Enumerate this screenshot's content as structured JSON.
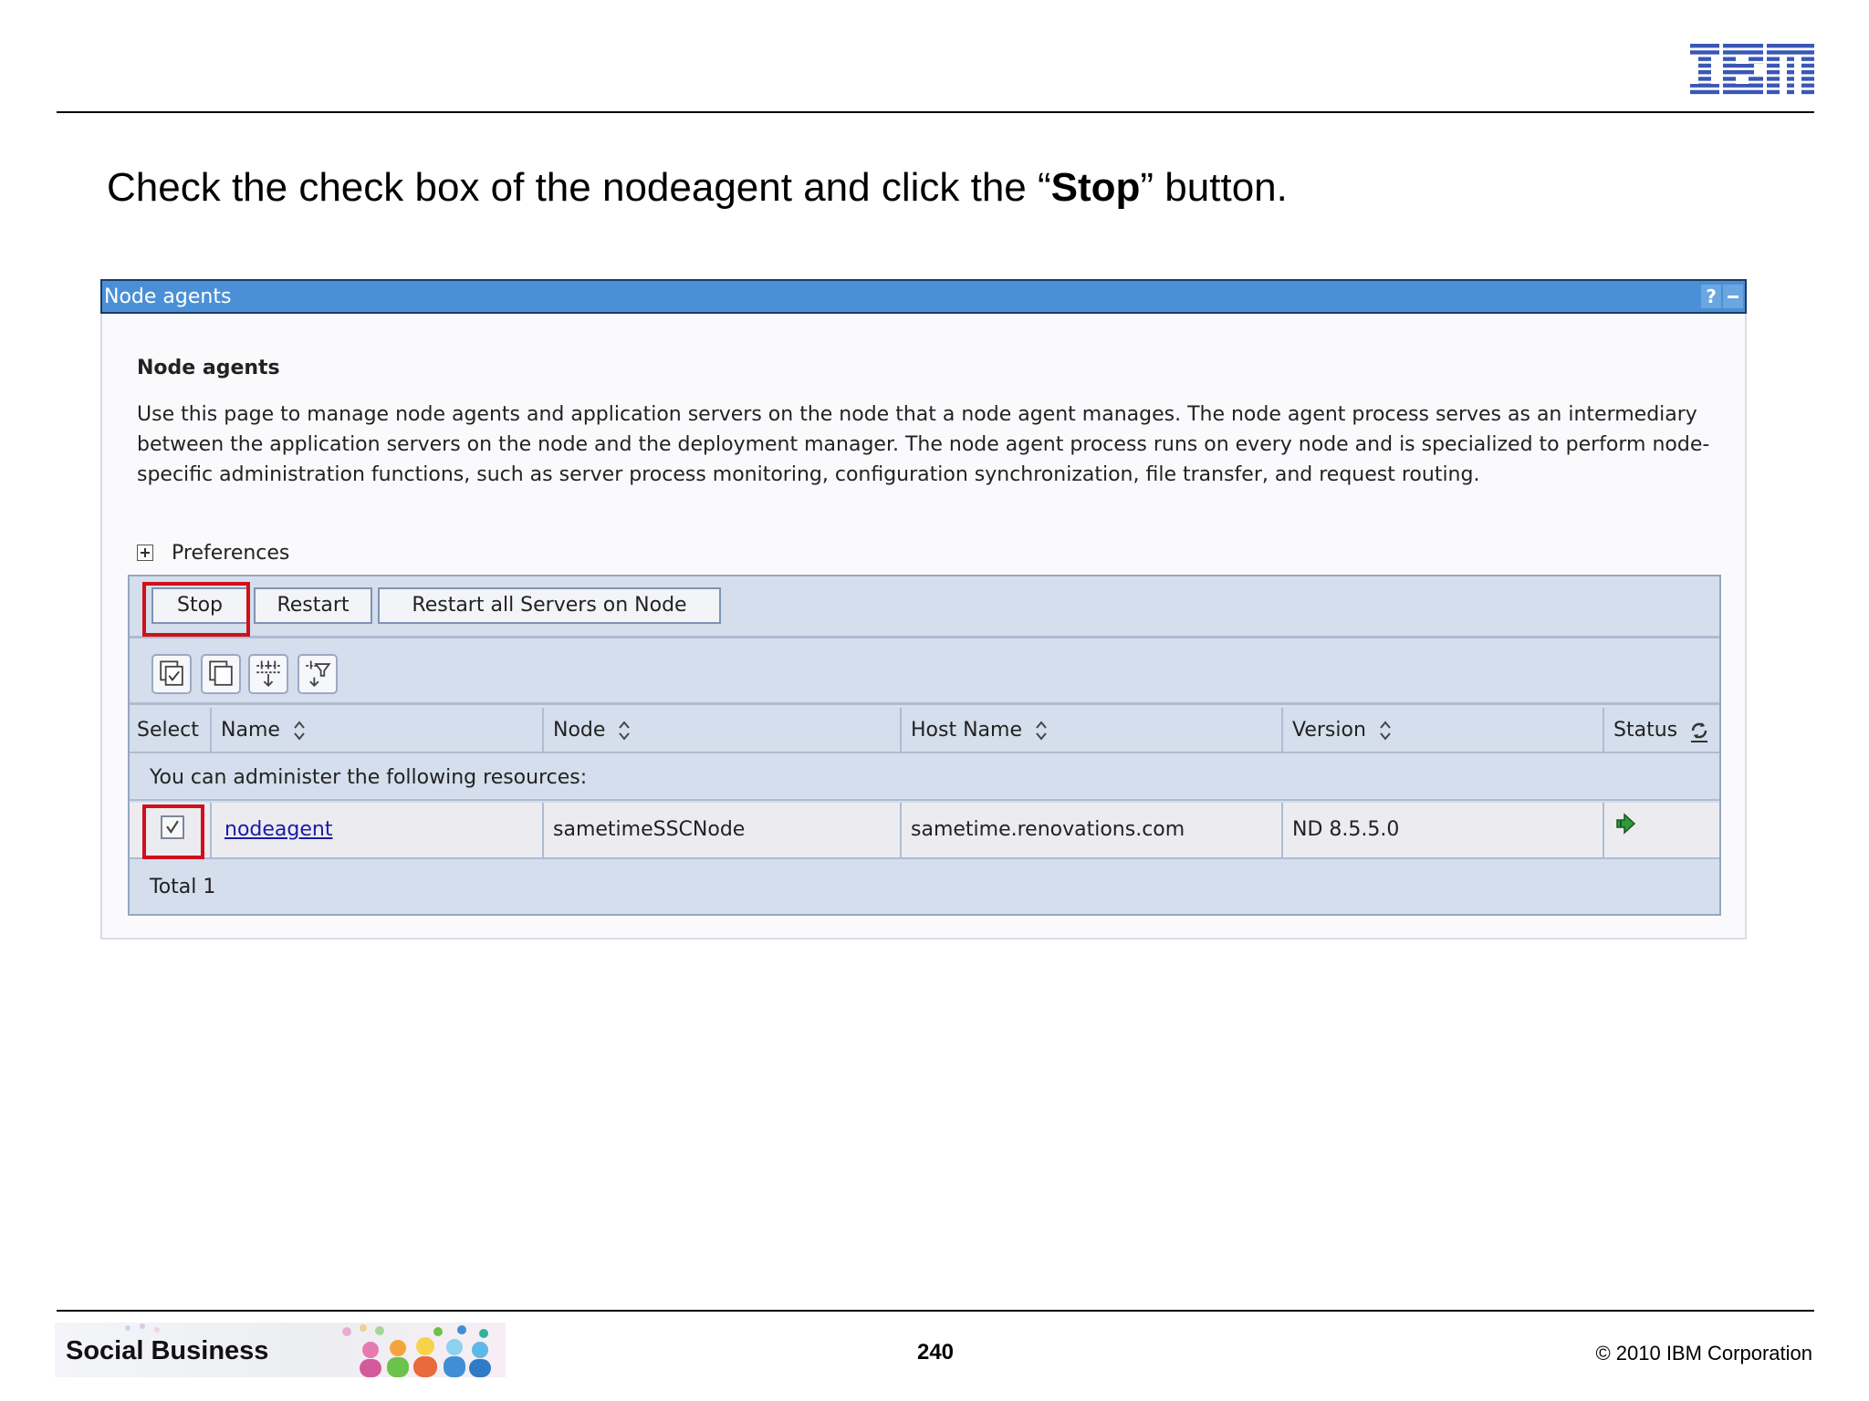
{
  "slide": {
    "logo_text": "IBM",
    "instruction": {
      "prefix": "Check the check box of the nodeagent and click the “",
      "emphasis": "Stop",
      "suffix": "” button."
    },
    "footer": {
      "brand": "Social Business",
      "page_number": "240",
      "copyright": "© 2010 IBM Corporation"
    }
  },
  "portlet": {
    "titlebar": "Node agents",
    "help_label": "?",
    "heading": "Node agents",
    "description": "Use this page to manage node agents and application servers on the node that a node agent manages. The node agent process serves as an intermediary between the application servers on the node and the deployment manager. The node agent process runs on every node and is specialized to perform node-specific administration functions, such as server process monitoring, configuration synchronization, file transfer, and request routing.",
    "preferences_label": "Preferences",
    "buttons": {
      "stop": "Stop",
      "restart": "Restart",
      "restart_all": "Restart all Servers on Node"
    },
    "tool_icons": [
      "select-all-icon",
      "deselect-all-icon",
      "show-filter-icon",
      "clear-filter-icon"
    ],
    "table": {
      "columns": [
        "Select",
        "Name",
        "Node",
        "Host Name",
        "Version",
        "Status"
      ],
      "info_message": "You can administer the following resources:",
      "rows": [
        {
          "selected": true,
          "name": "nodeagent",
          "node": "sametimeSSCNode",
          "host_name": "sametime.renovations.com",
          "version": "ND 8.5.5.0",
          "status": "started"
        }
      ],
      "total": "Total 1"
    }
  },
  "colors": {
    "titlebar": "#4b90d6",
    "table_bg": "#d4deec",
    "highlight": "#d0101a",
    "link": "#1a1aa6",
    "status_started": "#2e9a3a"
  }
}
